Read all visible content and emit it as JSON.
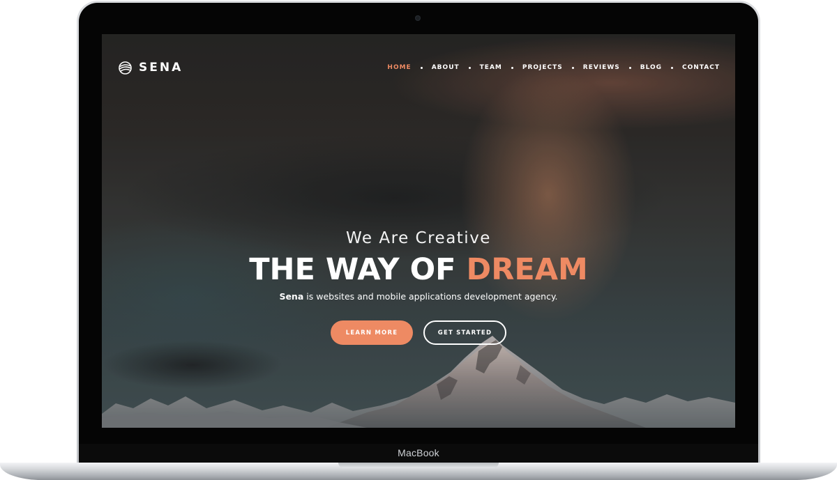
{
  "device": {
    "label": "MacBook"
  },
  "site": {
    "logo_text": "SENA",
    "accent_color": "#ee8a63",
    "nav": [
      {
        "label": "HOME",
        "active": true
      },
      {
        "label": "ABOUT",
        "active": false
      },
      {
        "label": "TEAM",
        "active": false
      },
      {
        "label": "PROJECTS",
        "active": false
      },
      {
        "label": "REVIEWS",
        "active": false
      },
      {
        "label": "BLOG",
        "active": false
      },
      {
        "label": "CONTACT",
        "active": false
      }
    ],
    "hero": {
      "kicker": "We Are Creative",
      "title_main": "THE WAY OF",
      "title_accent": "DREAM",
      "subtitle_bold": "Sena",
      "subtitle_rest": "is websites and mobile applications development agency."
    },
    "buttons": {
      "primary": "LEARN MORE",
      "secondary": "GET STARTED"
    }
  }
}
